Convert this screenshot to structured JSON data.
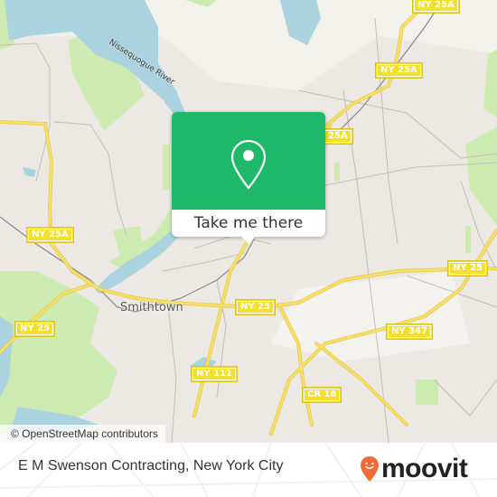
{
  "map": {
    "place_label": "Smithtown",
    "river_label": "Nissequogue River",
    "road_shields": [
      {
        "label": "NY 25A"
      },
      {
        "label": "NY 25A"
      },
      {
        "label": "25A"
      },
      {
        "label": "NY 25A"
      },
      {
        "label": "NY 25"
      },
      {
        "label": "NY 25"
      },
      {
        "label": "NY 25"
      },
      {
        "label": "NY 347"
      },
      {
        "label": "NY 111"
      },
      {
        "label": "CR 16"
      }
    ],
    "attribution": "© OpenStreetMap contributors",
    "colors": {
      "land": "#f1efe9",
      "water": "#aad3df",
      "park": "#cdebb0",
      "road": "#f7e06a",
      "accent": "#1db868"
    }
  },
  "popup": {
    "icon": "map-pin-icon",
    "action_label": "Take me there"
  },
  "footer": {
    "location_title": "E M Swenson Contracting, New York City",
    "brand": "moovit",
    "brand_color": "#f26a36"
  }
}
